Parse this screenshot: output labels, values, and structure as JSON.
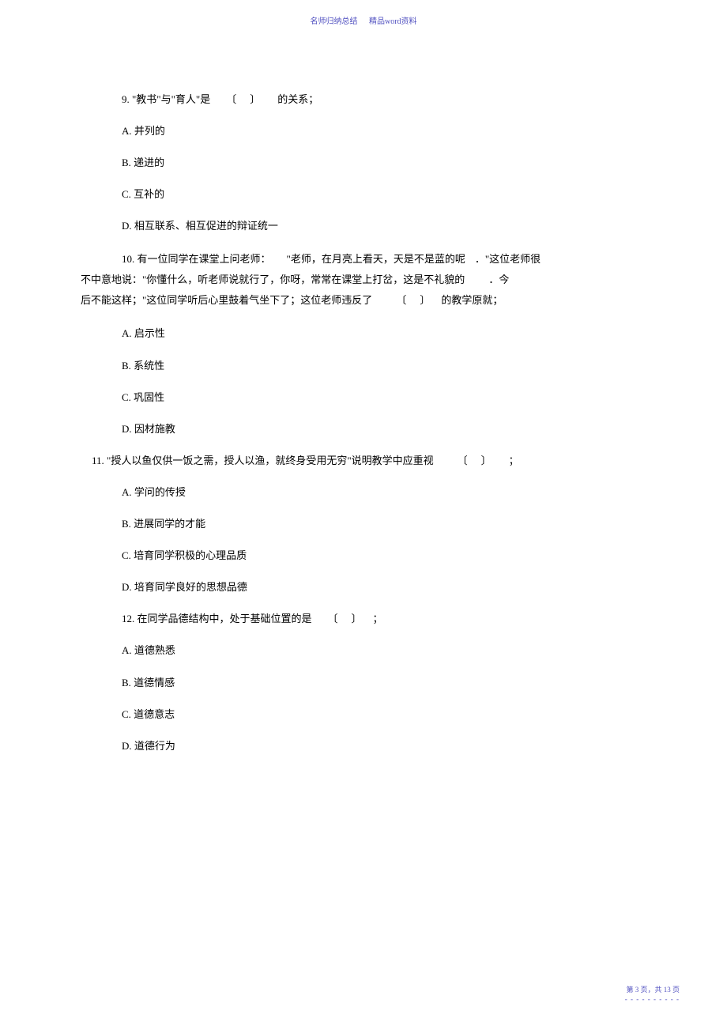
{
  "header": {
    "left": "名师归纳总结",
    "right": "精品word资料"
  },
  "questions": {
    "q9": {
      "stem_pre": "9. \"教书\"与\"育人\"是",
      "stem_post": "的关系；",
      "bracket": "〔　〕",
      "options": {
        "a": "A. 并列的",
        "b": "B. 递进的",
        "c": "C. 互补的",
        "d": "D. 相互联系、相互促进的辩证统一"
      }
    },
    "q10": {
      "line1_a": "10. 有一位同学在课堂上问老师：",
      "line1_b": "\"老师，在月亮上看天，天是不是蓝的呢",
      "line1_c": "．\"这位老师很",
      "line2_a": "不中意地说：\"你懂什么，听老师说就行了，你呀，常常在课堂上打岔，这是不礼貌的",
      "line2_b": "．今",
      "line3_a": "后不能这样；\"这位同学听后心里鼓着气坐下了；这位老师违反了",
      "line3_b": "的教学原就；",
      "bracket": "〔　〕",
      "options": {
        "a": "A. 启示性",
        "b": "B. 系统性",
        "c": "C. 巩固性",
        "d": "D. 因材施教"
      }
    },
    "q11": {
      "stem_pre": "11. \"授人以鱼仅供一饭之需，授人以渔，就终身受用无穷\"说明教学中应重视",
      "stem_post": "；",
      "bracket": "〔　〕",
      "options": {
        "a": "A. 学问的传授",
        "b": "B. 进展同学的才能",
        "c": "C. 培育同学积极的心理品质",
        "d": "D. 培育同学良好的思想品德"
      }
    },
    "q12": {
      "stem_pre": "12. 在同学品德结构中，处于基础位置的是",
      "stem_post": "；",
      "bracket": "〔　〕",
      "options": {
        "a": "A. 道德熟悉",
        "b": "B. 道德情感",
        "c": "C. 道德意志",
        "d": "D. 道德行为"
      }
    }
  },
  "footer": {
    "text_pre": "第 ",
    "page_current": "3",
    "text_mid": " 页，共 ",
    "page_total": "13",
    "text_post": " 页",
    "dashes": "- - - - - - - - - -"
  }
}
